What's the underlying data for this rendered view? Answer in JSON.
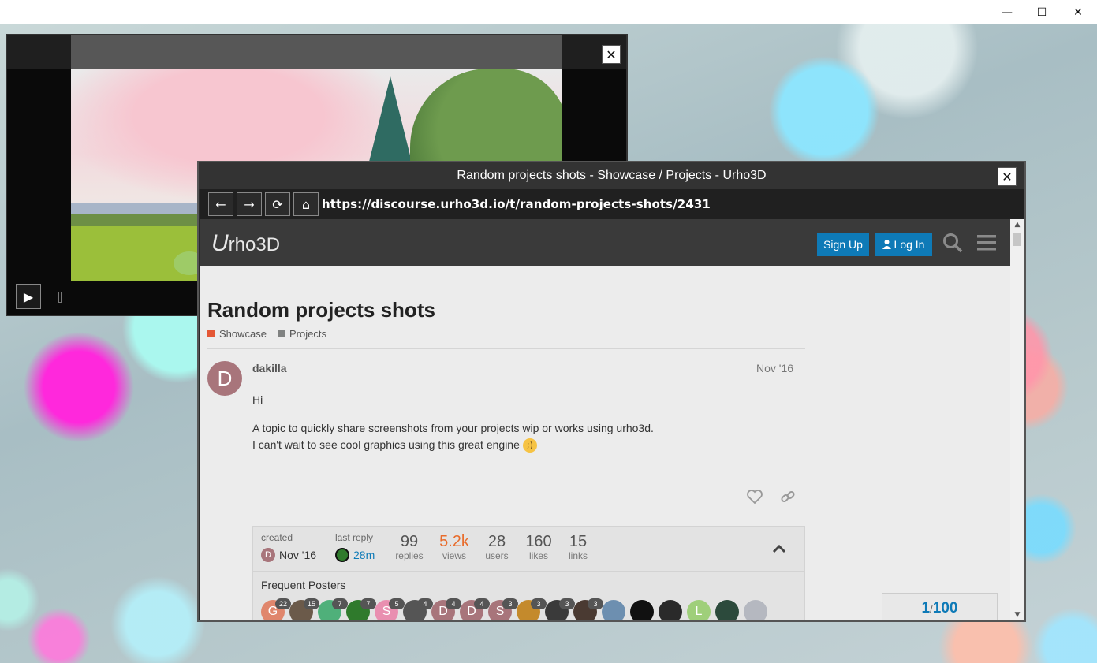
{
  "os_window": {
    "minimize_glyph": "—",
    "maximize_glyph": "☐",
    "close_glyph": "✕"
  },
  "video_player": {
    "close_glyph": "✕",
    "play_glyph": "▶"
  },
  "browser": {
    "title": "Random projects shots - Showcase / Projects - Urho3D",
    "close_glyph": "✕",
    "nav": {
      "back_glyph": "←",
      "forward_glyph": "→",
      "reload_glyph": "⟳",
      "home_glyph": "⌂"
    },
    "url": "https://discourse.urho3d.io/t/random-projects-shots/2431"
  },
  "site": {
    "logo_u": "U",
    "logo_rest": "rho3D",
    "signup_label": "Sign Up",
    "login_label": "Log In",
    "search_glyph": "⌕",
    "menu_glyph": "≡"
  },
  "topic": {
    "title": "Random projects shots",
    "categories": [
      {
        "name": "Showcase",
        "color": "#e45735"
      },
      {
        "name": "Projects",
        "color": "#808281"
      }
    ]
  },
  "post": {
    "avatar_letter": "D",
    "avatar_color": "#a8757b",
    "username": "dakilla",
    "date": "Nov '16",
    "lines": [
      "Hi",
      "A topic to quickly share screenshots from your projects wip or works using urho3d.",
      "I can't wait to see cool graphics using this great engine"
    ],
    "emoji": "wink"
  },
  "summary": {
    "created_label": "created",
    "created_value": "Nov '16",
    "created_avatar": "D",
    "last_reply_label": "last reply",
    "last_reply_value": "28m",
    "stats": [
      {
        "num": "99",
        "label": "replies",
        "highlight": false
      },
      {
        "num": "5.2k",
        "label": "views",
        "highlight": true
      },
      {
        "num": "28",
        "label": "users",
        "highlight": false
      },
      {
        "num": "160",
        "label": "likes",
        "highlight": false
      },
      {
        "num": "15",
        "label": "links",
        "highlight": false
      }
    ],
    "collapse_glyph": "^",
    "frequent_posters_label": "Frequent Posters",
    "posters": [
      {
        "letter": "G",
        "count": "22",
        "color": "#e0866c"
      },
      {
        "letter": "",
        "count": "15",
        "color": "#6b5a4a"
      },
      {
        "letter": "",
        "count": "7",
        "color": "#4fb07a"
      },
      {
        "letter": "",
        "count": "7",
        "color": "#2f7a2c"
      },
      {
        "letter": "S",
        "count": "5",
        "color": "#e98fb0"
      },
      {
        "letter": "",
        "count": "4",
        "color": "#555555"
      },
      {
        "letter": "D",
        "count": "4",
        "color": "#a8757b"
      },
      {
        "letter": "D",
        "count": "4",
        "color": "#a8757b"
      },
      {
        "letter": "S",
        "count": "3",
        "color": "#a8757b"
      },
      {
        "letter": "",
        "count": "3",
        "color": "#c48a2c"
      },
      {
        "letter": "",
        "count": "3",
        "color": "#3a3a3a"
      },
      {
        "letter": "",
        "count": "3",
        "color": "#4a3a32"
      },
      {
        "letter": "",
        "count": "",
        "color": "#6d8fb0"
      },
      {
        "letter": "",
        "count": "",
        "color": "#111111"
      },
      {
        "letter": "",
        "count": "",
        "color": "#2a2a2a"
      },
      {
        "letter": "L",
        "count": "",
        "color": "#9fcf7a"
      },
      {
        "letter": "",
        "count": "",
        "color": "#2c4a3c"
      },
      {
        "letter": "",
        "count": "",
        "color": "#b5b8c0"
      }
    ]
  },
  "progress": {
    "current": "1",
    "separator": "/",
    "total": "100"
  }
}
